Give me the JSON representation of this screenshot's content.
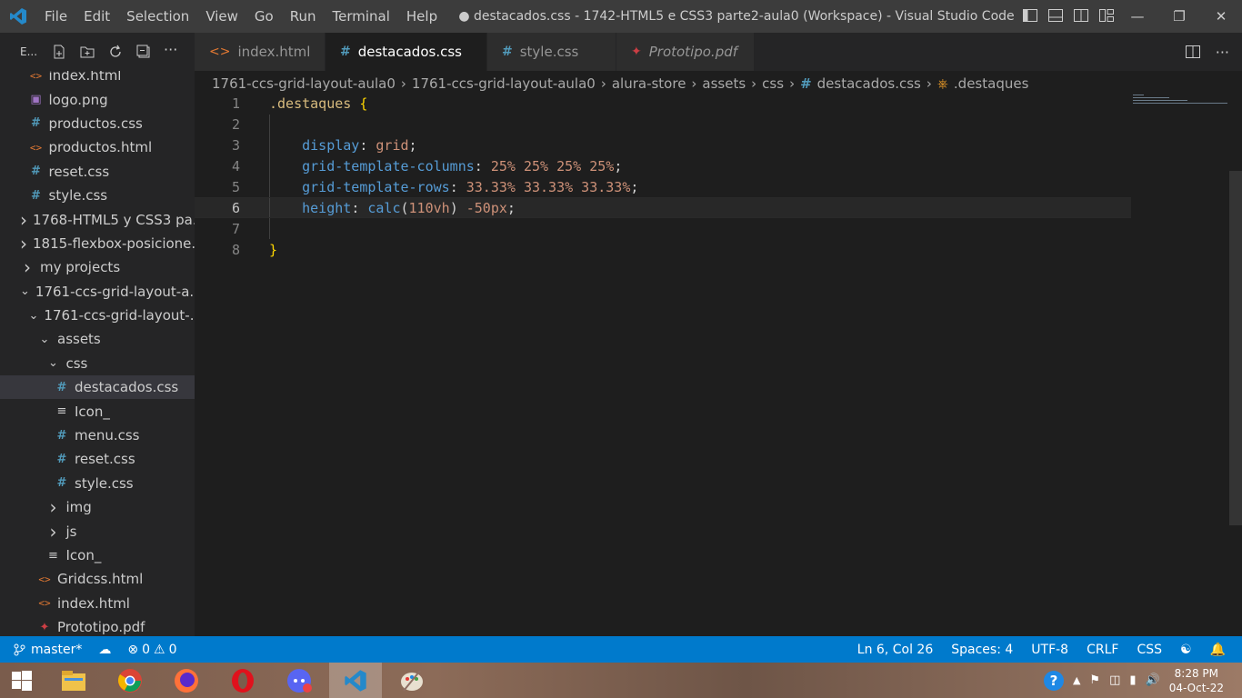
{
  "titlebar": {
    "menu": [
      "File",
      "Edit",
      "Selection",
      "View",
      "Go",
      "Run",
      "Terminal",
      "Help"
    ],
    "window_title": "● destacados.css - 1742-HTML5 e CSS3 parte2-aula0 (Workspace) - Visual Studio Code"
  },
  "explorer": {
    "label": "E..."
  },
  "tabs": [
    {
      "label": "index.html",
      "icon": "html-icon"
    },
    {
      "label": "destacados.css",
      "icon": "css-hash-icon",
      "active": true,
      "modified": true
    },
    {
      "label": "style.css",
      "icon": "css-hash-icon"
    },
    {
      "label": "Prototipo.pdf",
      "icon": "pdf-icon"
    }
  ],
  "sidebar": {
    "items": [
      {
        "label": "index.html",
        "icon": "html",
        "indent": 1
      },
      {
        "label": "logo.png",
        "icon": "png",
        "indent": 1
      },
      {
        "label": "productos.css",
        "icon": "hash",
        "indent": 1
      },
      {
        "label": "productos.html",
        "icon": "html",
        "indent": 1
      },
      {
        "label": "reset.css",
        "icon": "hash",
        "indent": 1
      },
      {
        "label": "style.css",
        "icon": "hash",
        "indent": 1
      },
      {
        "label": "1768-HTML5 y CSS3 pa...",
        "icon": "chevron-right",
        "indent": 0
      },
      {
        "label": "1815-flexbox-posicione...",
        "icon": "chevron-right",
        "indent": 0
      },
      {
        "label": "my projects",
        "icon": "chevron-right",
        "indent": 0
      },
      {
        "label": "1761-ccs-grid-layout-a...",
        "icon": "chevron-down",
        "indent": 0
      },
      {
        "label": "1761-ccs-grid-layout-...",
        "icon": "chevron-down",
        "indent": 1
      },
      {
        "label": "assets",
        "icon": "chevron-down",
        "indent": 2
      },
      {
        "label": "css",
        "icon": "chevron-down",
        "indent": 3
      },
      {
        "label": "destacados.css",
        "icon": "hash",
        "indent": 4,
        "selected": true
      },
      {
        "label": "Icon_",
        "icon": "txt",
        "indent": 4
      },
      {
        "label": "menu.css",
        "icon": "hash",
        "indent": 4
      },
      {
        "label": "reset.css",
        "icon": "hash",
        "indent": 4
      },
      {
        "label": "style.css",
        "icon": "hash",
        "indent": 4
      },
      {
        "label": "img",
        "icon": "chevron-right",
        "indent": 3
      },
      {
        "label": "js",
        "icon": "chevron-right",
        "indent": 3
      },
      {
        "label": "Icon_",
        "icon": "txt",
        "indent": 3
      },
      {
        "label": "Gridcss.html",
        "icon": "html",
        "indent": 2
      },
      {
        "label": "index.html",
        "icon": "html",
        "indent": 2
      },
      {
        "label": "Prototipo.pdf",
        "icon": "pdf",
        "indent": 2
      }
    ]
  },
  "breadcrumb": [
    "1761-ccs-grid-layout-aula0",
    "1761-ccs-grid-layout-aula0",
    "alura-store",
    "assets",
    "css",
    "destacados.css",
    ".destaques"
  ],
  "editor": {
    "lines": [
      {
        "n": "1",
        "tokens": [
          {
            "t": ".destaques",
            "c": "sel"
          },
          {
            "t": " ",
            "c": "punct"
          },
          {
            "t": "{",
            "c": "brace"
          }
        ]
      },
      {
        "n": "2",
        "tokens": []
      },
      {
        "n": "3",
        "tokens": [
          {
            "t": "    display",
            "c": "prop"
          },
          {
            "t": ": ",
            "c": "punct"
          },
          {
            "t": "grid",
            "c": "val"
          },
          {
            "t": ";",
            "c": "punct"
          }
        ]
      },
      {
        "n": "4",
        "tokens": [
          {
            "t": "    grid-template-columns",
            "c": "prop"
          },
          {
            "t": ": ",
            "c": "punct"
          },
          {
            "t": "25% 25% 25% 25%",
            "c": "val"
          },
          {
            "t": ";",
            "c": "punct"
          }
        ]
      },
      {
        "n": "5",
        "tokens": [
          {
            "t": "    grid-template-rows",
            "c": "prop"
          },
          {
            "t": ": ",
            "c": "punct"
          },
          {
            "t": "33.33% 33.33% 33.33%",
            "c": "val"
          },
          {
            "t": ";",
            "c": "punct"
          }
        ]
      },
      {
        "n": "6",
        "tokens": [
          {
            "t": "    height",
            "c": "prop"
          },
          {
            "t": ": ",
            "c": "punct"
          },
          {
            "t": "calc",
            "c": "prop"
          },
          {
            "t": "(",
            "c": "punct"
          },
          {
            "t": "110vh",
            "c": "val"
          },
          {
            "t": ") ",
            "c": "punct"
          },
          {
            "t": "-50px",
            "c": "val"
          },
          {
            "t": ";",
            "c": "punct"
          }
        ],
        "current": true
      },
      {
        "n": "7",
        "tokens": []
      },
      {
        "n": "8",
        "tokens": [
          {
            "t": "}",
            "c": "brace"
          }
        ]
      }
    ]
  },
  "statusbar": {
    "branch": "master*",
    "errors": "0",
    "warnings": "0",
    "position": "Ln 6, Col 26",
    "spaces": "Spaces: 4",
    "encoding": "UTF-8",
    "eol": "CRLF",
    "language": "CSS"
  },
  "taskbar": {
    "time": "8:28 PM",
    "date": "04-Oct-22"
  },
  "colors": {
    "accent": "#007acc",
    "titlebar": "#3c3c3c",
    "sidebar": "#252526",
    "editor": "#1e1e1e"
  }
}
